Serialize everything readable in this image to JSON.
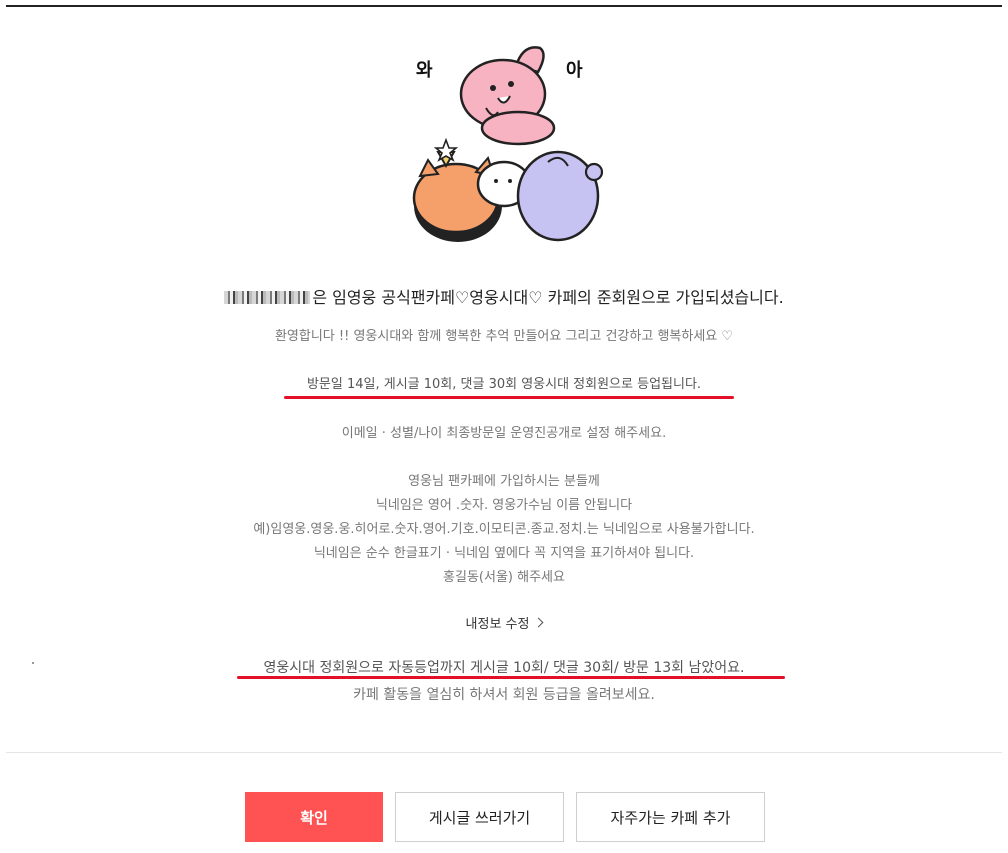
{
  "illustration": {
    "left_word": "와",
    "right_word": "아",
    "colors": {
      "pink": "#f7b3c2",
      "orange": "#f5a06a",
      "purple": "#c6c2f2",
      "white": "#ffffff"
    }
  },
  "welcome": {
    "suffix": "은 임영웅 공식팬카페♡영웅시대♡ 카페의 준회원으로 가입되셨습니다."
  },
  "greeting": "환영합니다 !! 영웅시대와 함께 행복한 추억 만들어요 그리고 건강하고 행복하세요 ♡",
  "condition": "방문일 14일, 게시글 10회, 댓글 30회 영웅시대 정회원으로 등업됩니다.",
  "settings_note": "이메일 · 성별/나이 최종방문일 운영진공개로 설정 해주세요.",
  "notice": [
    "영웅님 팬카페에 가입하시는 분들께",
    "닉네임은 영어 .숫자. 영웅가수님 이름 안됩니다",
    "예)임영웅.영웅.웅.히어로.숫자.영어.기호.이모티콘.종교.정치.는 닉네임으로 사용불가합니다.",
    "닉네임은 순수 한글표기 · 닉네임 옆에다 꼭 지역을 표기하셔야 됩니다.",
    "홍길동(서울) 해주세요"
  ],
  "edit_profile_link": "내정보 수정",
  "remaining": "영웅시대 정회원으로 자동등업까지 게시글 10회/ 댓글 30회/ 방문 13회 남았어요.",
  "encourage": "카페 활동을 열심히 하셔서 회원 등급을 올려보세요.",
  "buttons": {
    "confirm": "확인",
    "write_post": "게시글 쓰러가기",
    "add_favorite": "자주가는 카페 추가"
  },
  "accent_color": "#ff5353",
  "underline_color": "#e3102a"
}
